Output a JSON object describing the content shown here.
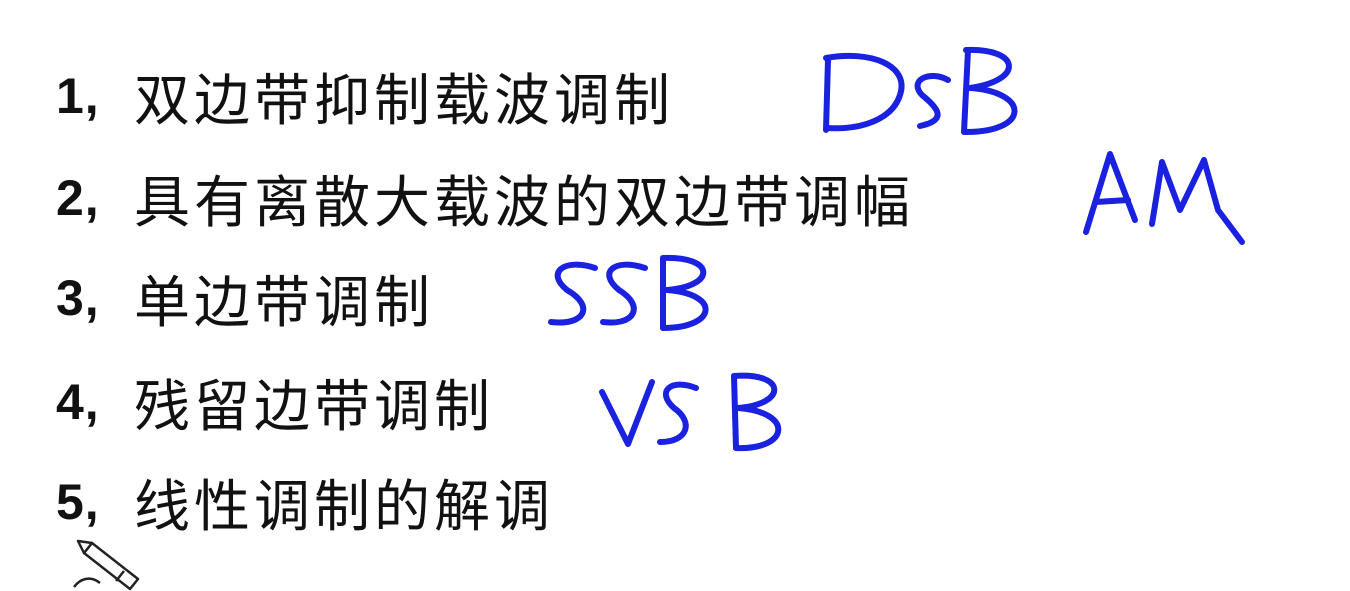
{
  "items": [
    {
      "number": "1,",
      "text": "双边带抑制载波调制",
      "annotation": "DSB"
    },
    {
      "number": "2,",
      "text": "具有离散大载波的双边带调幅",
      "annotation": "AM"
    },
    {
      "number": "3,",
      "text": "单边带调制",
      "annotation": "SSB"
    },
    {
      "number": "4,",
      "text": "残留边带调制",
      "annotation": "VSB"
    },
    {
      "number": "5,",
      "text": "线性调制的解调"
    }
  ],
  "colors": {
    "text": "#111111",
    "annotation": "#1a22e0",
    "background": "#ffffff"
  },
  "icons": {
    "cursor": "pen-cursor-icon"
  }
}
